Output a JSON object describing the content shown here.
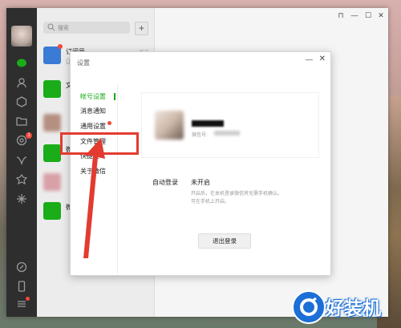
{
  "chat_list": {
    "search_placeholder": "搜索",
    "add_label": "+",
    "items": [
      {
        "name": "订阅号",
        "sub": "辽",
        "time": "昨天"
      },
      {
        "name": "文",
        "sub": "",
        "time": ""
      },
      {
        "name": "",
        "sub": "",
        "time": ""
      },
      {
        "name": "微",
        "sub": "",
        "time": ""
      },
      {
        "name": "",
        "sub": "",
        "time": ""
      },
      {
        "name": "微",
        "sub": "",
        "time": ""
      }
    ]
  },
  "sidebar": {
    "badge_count": "1"
  },
  "window_controls": {
    "pin": "⊓",
    "minimize": "—",
    "maximize": "☐",
    "close": "✕"
  },
  "settings": {
    "title": "设置",
    "minimize": "—",
    "close": "✕",
    "nav": [
      {
        "label": "帐号设置",
        "active": true
      },
      {
        "label": "消息通知",
        "active": false
      },
      {
        "label": "通用设置",
        "active": false
      },
      {
        "label": "文件管理",
        "active": false
      },
      {
        "label": "快捷键",
        "active": false
      },
      {
        "label": "关于微信",
        "active": false
      }
    ],
    "account": {
      "wechat_id_label": "微信号:",
      "auto_login_label": "自动登录",
      "auto_login_value": "未开启",
      "auto_login_desc_1": "开启后，在本机登录微信将无需手机确认。",
      "auto_login_desc_2": "可在手机上开启。",
      "logout_label": "退出登录"
    }
  },
  "watermark": {
    "text": "好装机"
  },
  "colors": {
    "accent": "#1aad19",
    "highlight": "#e33b30",
    "badge": "#f04a3c"
  }
}
